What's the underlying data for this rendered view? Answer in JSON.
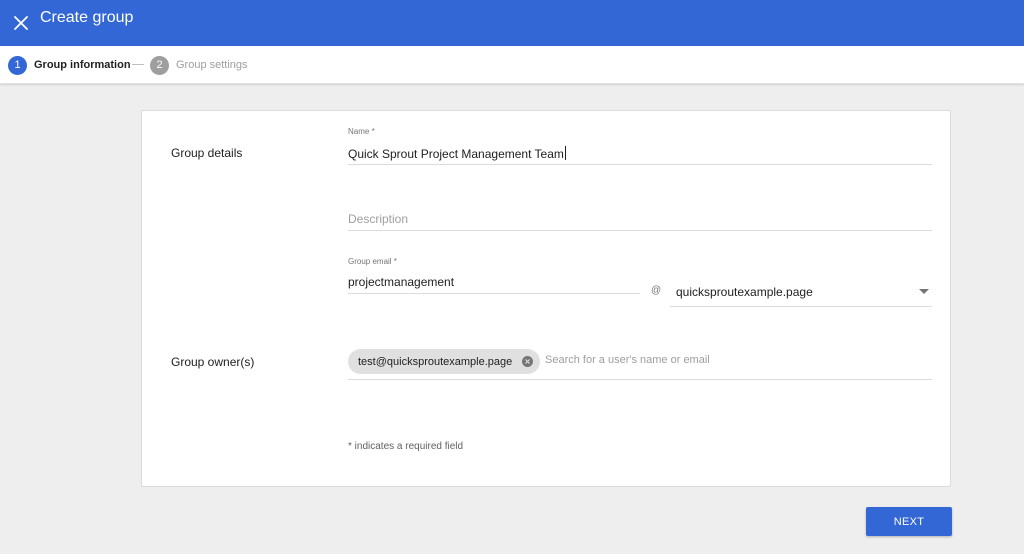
{
  "header": {
    "title": "Create group",
    "close_icon": "close-icon",
    "background_color": "#3367d6"
  },
  "stepper": {
    "steps": [
      {
        "number": "1",
        "label": "Group information",
        "state": "active"
      },
      {
        "number": "2",
        "label": "Group settings",
        "state": "inactive"
      }
    ]
  },
  "form": {
    "group_details_label": "Group details",
    "name": {
      "label": "Name *",
      "value": "Quick Sprout Project Management Team"
    },
    "description": {
      "placeholder": "Description",
      "value": ""
    },
    "group_email": {
      "label": "Group email *",
      "value": "projectmanagement",
      "at_sign": "@",
      "domain": "quicksproutexample.page"
    },
    "group_owners_label": "Group owner(s)",
    "owners": [
      "test@quicksproutexample.page"
    ],
    "owner_search_placeholder": "Search for a user's name or email",
    "required_note": "* indicates a required field"
  },
  "footer": {
    "next_label": "NEXT"
  },
  "colors": {
    "accent": "#3367d6",
    "inactive_step": "#9e9e9e",
    "page_background": "#eeeeee"
  }
}
